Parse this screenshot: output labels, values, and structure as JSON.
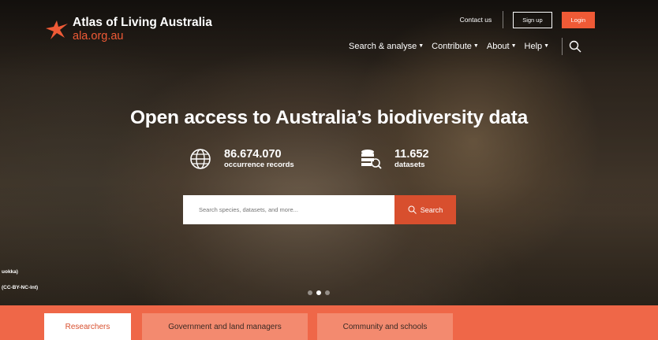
{
  "header": {
    "logo_title": "Atlas of Living Australia",
    "logo_subtitle": "ala.org.au",
    "contact_label": "Contact us",
    "signup_label": "Sign up",
    "login_label": "Login",
    "nav": [
      {
        "label": "Search & analyse"
      },
      {
        "label": "Contribute"
      },
      {
        "label": "About"
      },
      {
        "label": "Help"
      }
    ]
  },
  "hero": {
    "title": "Open access to Australia’s biodiversity data",
    "stats": [
      {
        "value": "86.674.070",
        "label": "occurrence records",
        "icon": "globe-icon"
      },
      {
        "value": "11.652",
        "label": "datasets",
        "icon": "database-search-icon"
      }
    ],
    "search_placeholder": "Search species, datasets, and more...",
    "search_button": "Search",
    "credit_line1": "uokka)",
    "credit_line2": "(CC-BY-NC-Int)"
  },
  "tabs": [
    {
      "label": "Researchers",
      "active": true
    },
    {
      "label": "Government and land managers",
      "active": false
    },
    {
      "label": "Community and schools",
      "active": false
    }
  ],
  "colors": {
    "accent": "#ef5a36",
    "tabbar": "#ef6748",
    "search_button": "#d84f2e"
  }
}
